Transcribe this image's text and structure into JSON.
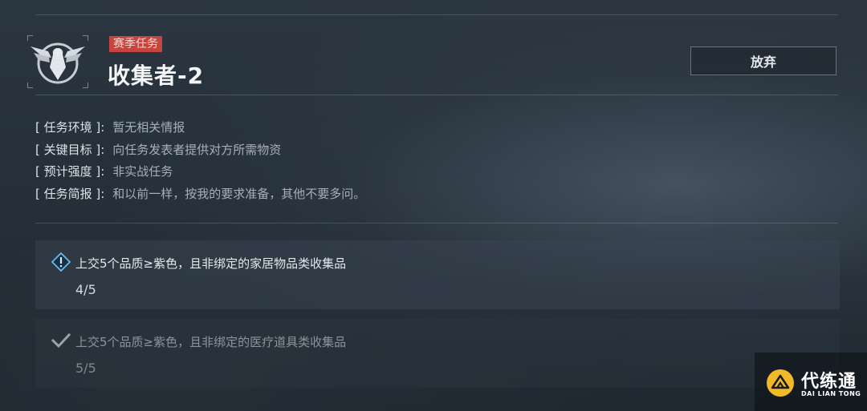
{
  "header": {
    "badge": "赛季任务",
    "title": "收集者-2",
    "abandon_label": "放弃"
  },
  "info": [
    {
      "label": "[ 任务环境 ]:",
      "value": "暂无相关情报"
    },
    {
      "label": "[ 关键目标 ]:",
      "value": "向任务发表者提供对方所需物资"
    },
    {
      "label": "[ 预计强度 ]:",
      "value": "非实战任务"
    },
    {
      "label": "[ 任务简报 ]:",
      "value": "和以前一样，按我的要求准备，其他不要多问。"
    }
  ],
  "objectives": [
    {
      "description": "上交5个品质≥紫色，且非绑定的家居物品类收集品",
      "progress": "4/5",
      "status": "in-progress",
      "icon": "info-diamond-icon"
    },
    {
      "description": "上交5个品质≥紫色，且非绑定的医疗道具类收集品",
      "progress": "5/5",
      "status": "completed",
      "icon": "check-icon"
    }
  ],
  "watermark": {
    "name": "代练通",
    "subtitle": "DAI LIAN TONG"
  },
  "colors": {
    "badge": "#c8453d",
    "logo": "#f0b92a"
  }
}
